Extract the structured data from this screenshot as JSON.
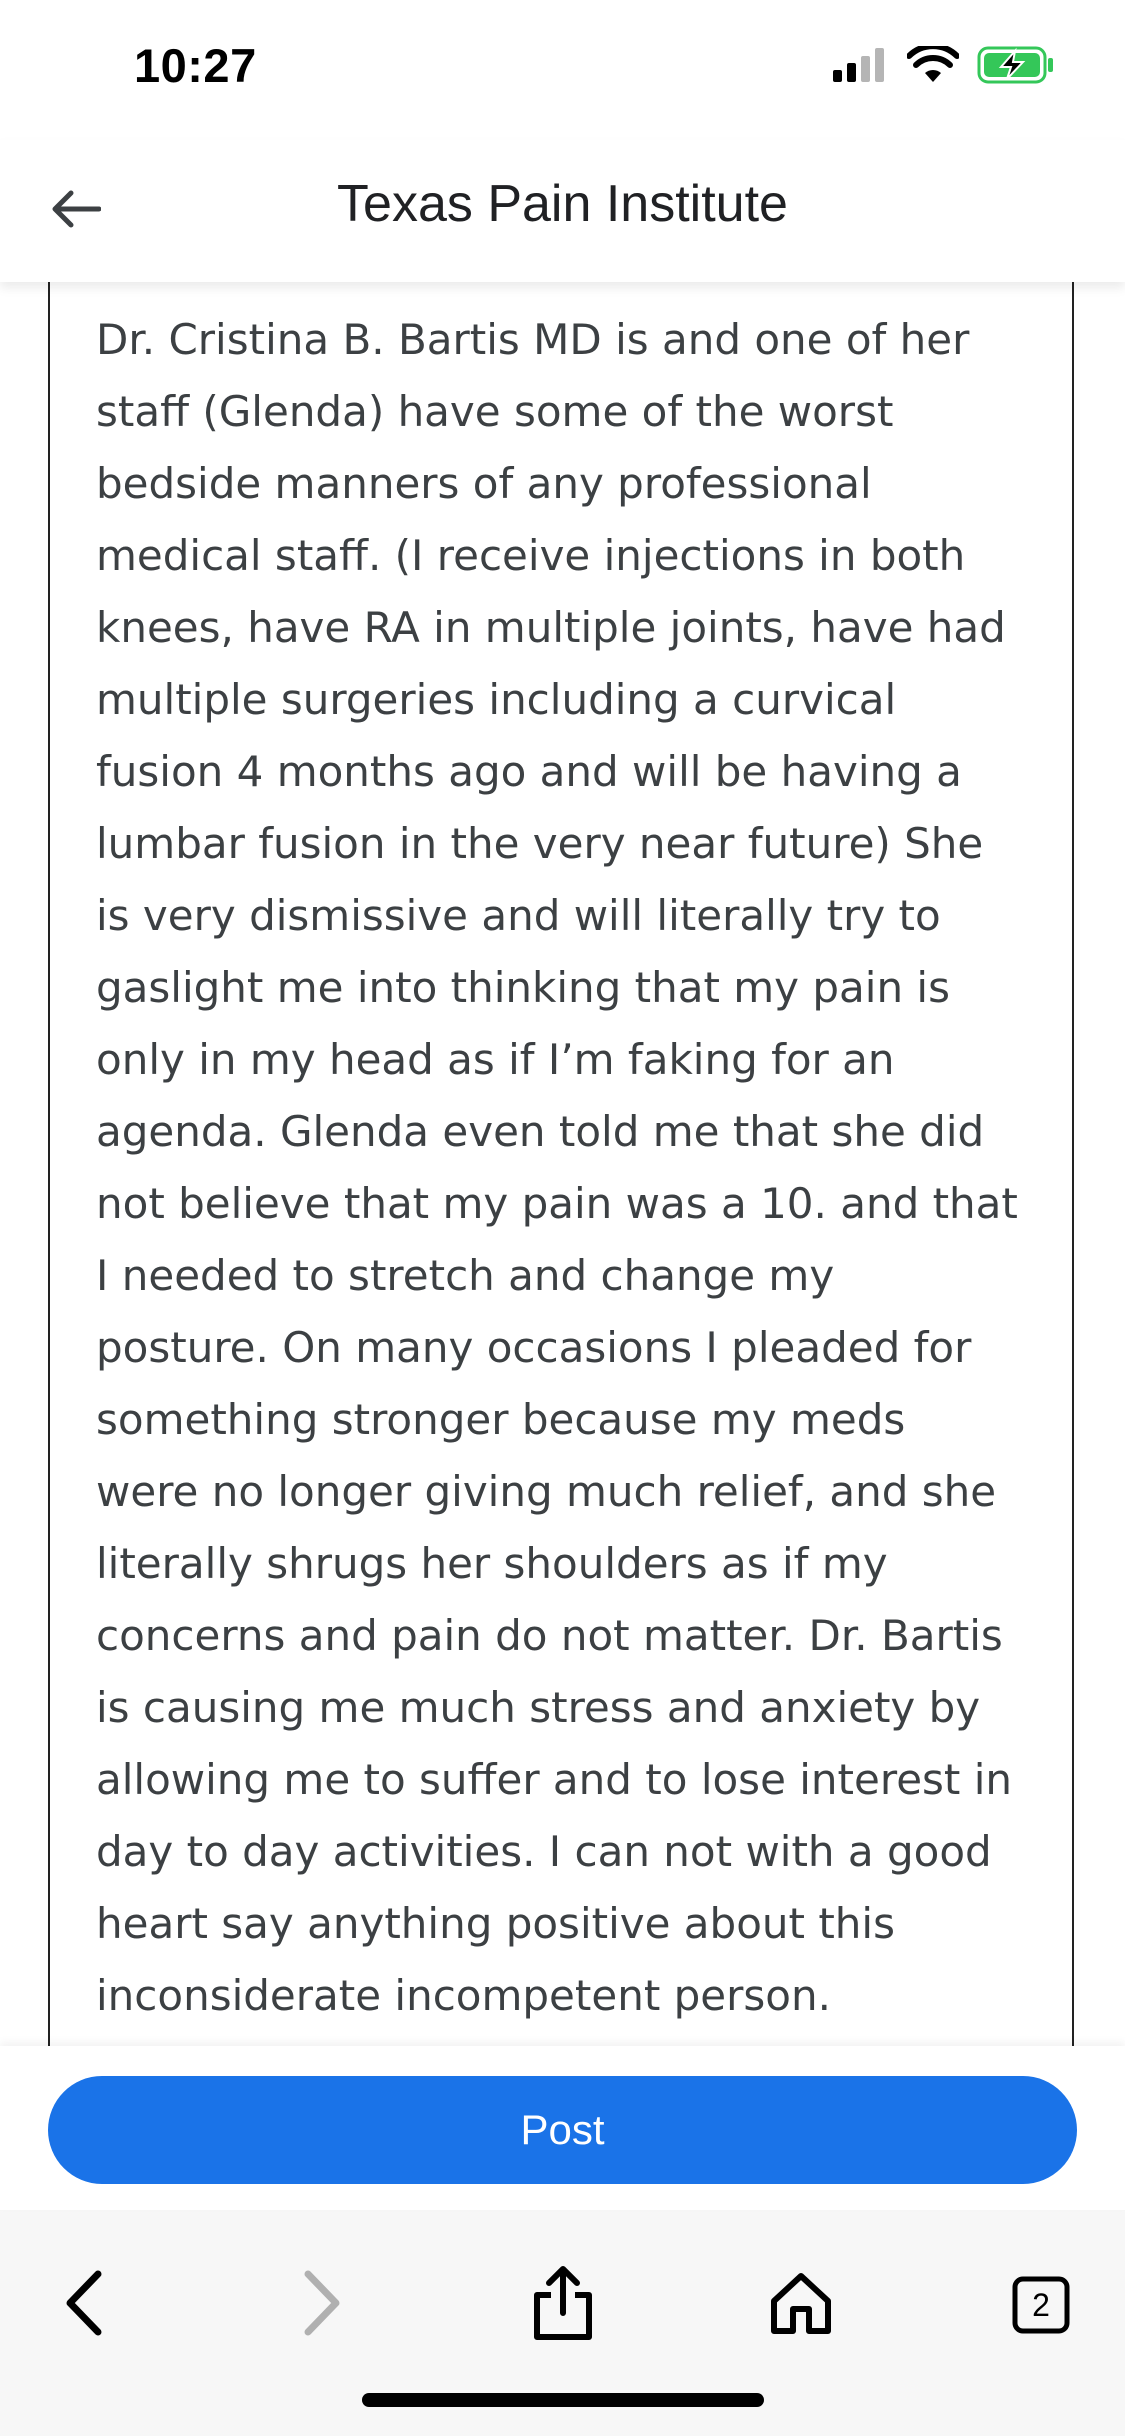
{
  "status_bar": {
    "time": "10:27",
    "icons": [
      "signal-icon",
      "wifi-icon",
      "battery-charging-icon"
    ],
    "battery_color": "#34c759"
  },
  "header": {
    "title": "Texas Pain Institute",
    "back_icon": "arrow-left-icon"
  },
  "review": {
    "text": "Dr. Cristina B. Bartis MD is and one of her\nstaff (Glenda) have some of the worst\nbedside manners of any professional\nmedical staff. (I receive injections in both\nknees, have RA in multiple joints, have had\nmultiple surgeries including a curvical\nfusion 4 months ago and will be having a\nlumbar fusion in the very near future) She\nis very dismissive and will literally try to\ngaslight me into thinking that my pain is\nonly in my head as if I’m faking for an\nagenda. Glenda even told me that she did\nnot believe that my pain was a 10. and that\nI needed to stretch and change my\nposture. On many occasions I pleaded for\nsomething stronger because my meds\nwere no longer giving much relief, and she\nliterally shrugs her shoulders as if  my\nconcerns and pain do not matter. Dr. Bartis\nis causing me much stress and anxiety by\nallowing me to suffer and to lose interest in\nday to day activities. I can not with a good\nheart say anything positive about this\ninconsiderate incompetent person."
  },
  "actions": {
    "post_label": "Post",
    "post_color": "#1a73e8"
  },
  "browser_toolbar": {
    "tab_count": "2",
    "icons": [
      "back-chevron-icon",
      "forward-chevron-icon",
      "share-icon",
      "home-icon",
      "tabs-icon"
    ]
  }
}
